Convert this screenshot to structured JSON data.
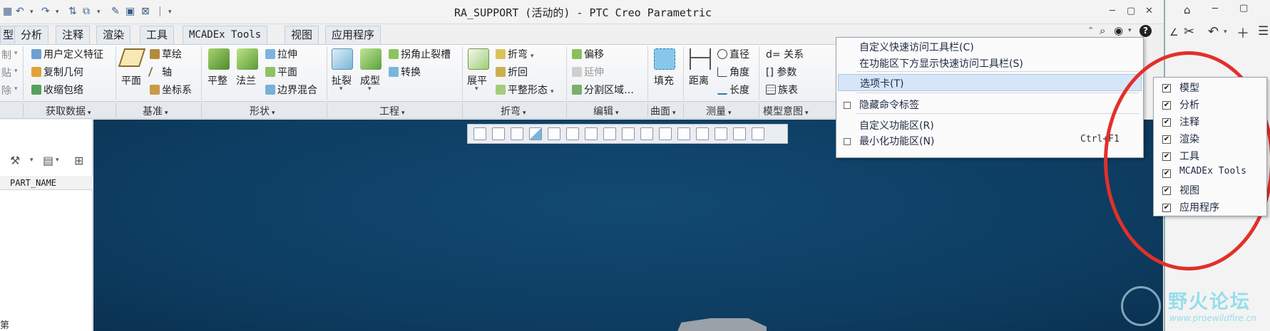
{
  "window": {
    "title": "RA_SUPPORT (活动的) - PTC Creo Parametric"
  },
  "tabs": [
    {
      "label": "型"
    },
    {
      "label": "分析"
    },
    {
      "label": "注释"
    },
    {
      "label": "渲染"
    },
    {
      "label": "工具"
    },
    {
      "label": "MCADEx Tools"
    },
    {
      "label": "视图"
    },
    {
      "label": "应用程序"
    }
  ],
  "ribbon": {
    "clipped_col": [
      "制",
      "贴",
      "除"
    ],
    "get_data": [
      "用户定义特征",
      "复制几何",
      "收缩包络"
    ],
    "datum_plane": "平面",
    "datum_small": [
      "草绘",
      "轴",
      "坐标系"
    ],
    "shape_big": [
      "平整",
      "法兰"
    ],
    "shape_small": [
      "拉伸",
      "平面",
      "边界混合"
    ],
    "eng_big": [
      "扯裂",
      "成型"
    ],
    "eng_small": [
      "拐角止裂槽",
      "转换"
    ],
    "bend_big": "展平",
    "bend_small": [
      "折弯",
      "折回",
      "平整形态"
    ],
    "edit": [
      "偏移",
      "延伸",
      "分割区域…"
    ],
    "fill": "填充",
    "distance": "距离",
    "measure": [
      "直径",
      "角度",
      "长度"
    ],
    "model_intent": [
      "d= 关系",
      "[] 参数",
      "族表"
    ]
  },
  "groups": [
    "获取数据",
    "基准",
    "形状",
    "工程",
    "折弯",
    "编辑",
    "曲面",
    "测量",
    "模型意图"
  ],
  "left_panel": {
    "column_header": "PART_NAME",
    "bottom_char": "第"
  },
  "context_menu": {
    "items": [
      "自定义快速访问工具栏(C)",
      "在功能区下方显示快速访问工具栏(S)",
      "选项卡(T)",
      "隐藏命令标签",
      "自定义功能区(R)",
      "最小化功能区(N)"
    ],
    "shortcut": "Ctrl+F1"
  },
  "submenu": {
    "items": [
      "模型",
      "分析",
      "注释",
      "渲染",
      "工具",
      "MCADEx Tools",
      "视图",
      "应用程序"
    ],
    "check_glyph": "✔"
  },
  "watermark": {
    "title": "野火论坛",
    "url": "www.proewildfire.cn"
  },
  "icons": {
    "close": "✕",
    "minimize": "─",
    "maximize": "▢",
    "caret": "▾",
    "submenu_arrow": "›",
    "help": "?",
    "scissors": "✂",
    "plus": "＋",
    "menu": "☰"
  },
  "colors": {
    "canvas": "#0d3c60",
    "annotation": "#e2302a",
    "menu_highlight": "#d6e6f8"
  }
}
